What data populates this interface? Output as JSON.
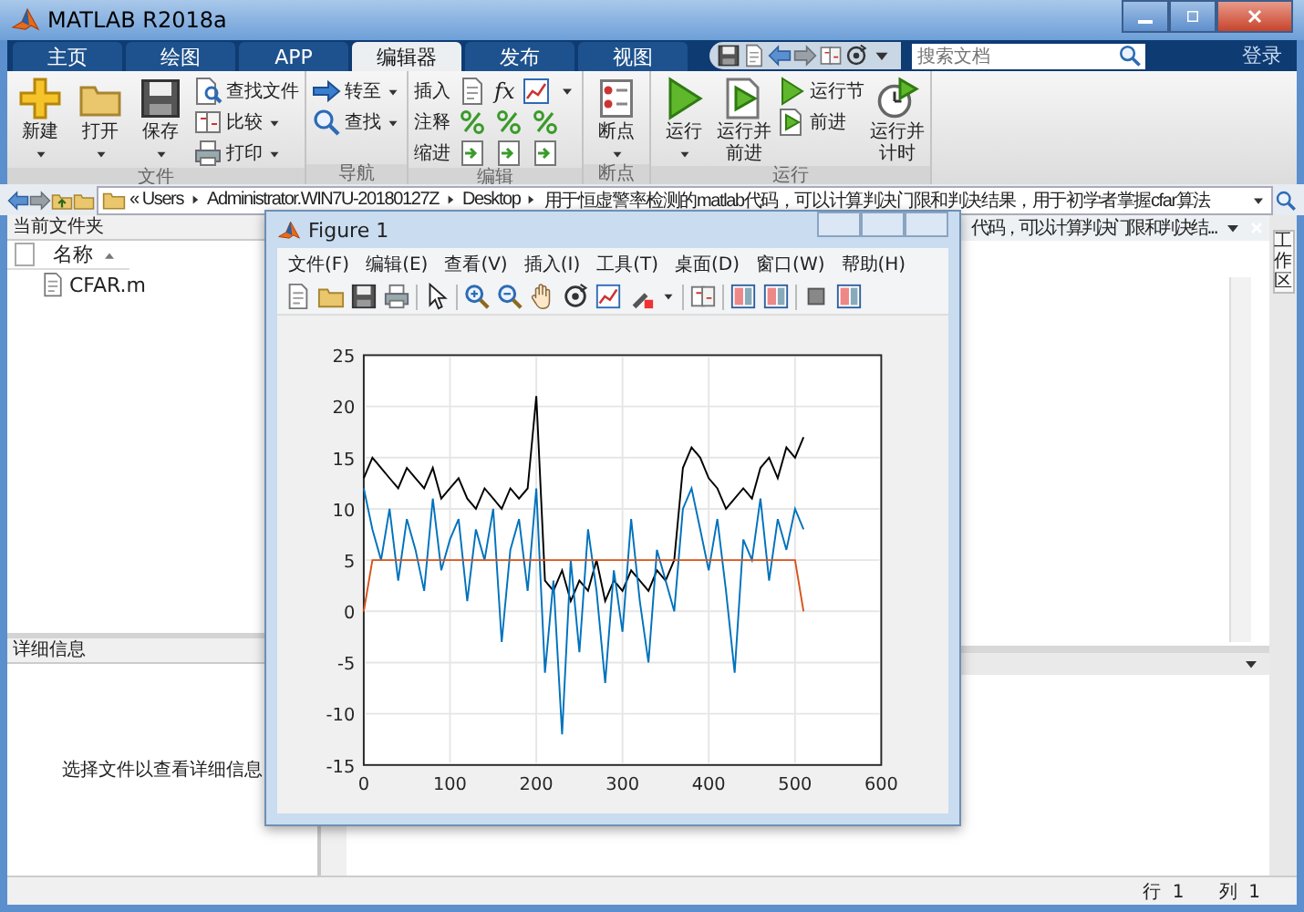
{
  "window": {
    "title": "MATLAB R2018a"
  },
  "tabs": [
    {
      "label": "主页",
      "selected": false
    },
    {
      "label": "绘图",
      "selected": false
    },
    {
      "label": "APP",
      "selected": false
    },
    {
      "label": "编辑器",
      "selected": true
    },
    {
      "label": "发布",
      "selected": false
    },
    {
      "label": "视图",
      "selected": false
    }
  ],
  "search": {
    "placeholder": "搜索文档"
  },
  "login": "登录",
  "ribbon": [
    {
      "title": "文件",
      "buttons": [
        {
          "label": "新建",
          "kind": "large",
          "dropdown": true
        },
        {
          "label": "打开",
          "kind": "large",
          "dropdown": true
        },
        {
          "label": "保存",
          "kind": "large",
          "dropdown": true
        },
        {
          "label": "查找文件",
          "kind": "small",
          "dropdown": false
        },
        {
          "label": "比较",
          "kind": "small",
          "dropdown": true
        },
        {
          "label": "打印",
          "kind": "small",
          "dropdown": true
        }
      ]
    },
    {
      "title": "导航",
      "buttons": [
        {
          "label": "转至",
          "kind": "small",
          "dropdown": true
        },
        {
          "label": "查找",
          "kind": "small",
          "dropdown": true
        }
      ]
    },
    {
      "title": "编辑",
      "buttons": [
        {
          "label": "插入",
          "kind": "small",
          "dropdown": false,
          "symbol": "fx"
        },
        {
          "label": "注释",
          "kind": "small",
          "dropdown": false
        },
        {
          "label": "缩进",
          "kind": "small",
          "dropdown": false
        }
      ]
    },
    {
      "title": "断点",
      "buttons": [
        {
          "label": "断点",
          "kind": "large",
          "dropdown": true
        }
      ]
    },
    {
      "title": "运行",
      "buttons": [
        {
          "label": "运行",
          "kind": "large",
          "dropdown": true
        },
        {
          "label": "运行并前进",
          "kind": "large",
          "dropdown": false
        },
        {
          "label": "运行节",
          "kind": "small",
          "dropdown": false
        },
        {
          "label": "前进",
          "kind": "small",
          "dropdown": false
        },
        {
          "label": "运行并计时",
          "kind": "large",
          "dropdown": false
        }
      ]
    }
  ],
  "address": {
    "overflow": "«",
    "path": [
      "Users",
      "Administrator.WIN7U-20180127Z",
      "Desktop",
      "用于恒虚警率检测的matlab代码，可以计算判决门限和判决结果，用于初学者掌握cfar算法"
    ]
  },
  "files": {
    "title": "当前文件夹",
    "column": "名称",
    "items": [
      {
        "name": "CFAR.m"
      }
    ]
  },
  "details": {
    "title": "详细信息",
    "message": "选择文件以查看详细信息"
  },
  "editor": {
    "tab_title": "代码，可以计算判决门限和判决结..."
  },
  "side_tab": "工作区",
  "figure": {
    "title": "Figure 1",
    "menus": [
      "文件(F)",
      "编辑(E)",
      "查看(V)",
      "插入(I)",
      "工具(T)",
      "桌面(D)",
      "窗口(W)",
      "帮助(H)"
    ],
    "chart_data": {
      "type": "line",
      "x": [
        0,
        10,
        20,
        30,
        40,
        50,
        60,
        70,
        80,
        90,
        100,
        110,
        120,
        130,
        140,
        150,
        160,
        170,
        180,
        190,
        200,
        210,
        220,
        230,
        240,
        250,
        260,
        270,
        280,
        290,
        300,
        310,
        320,
        330,
        340,
        350,
        360,
        370,
        380,
        390,
        400,
        410,
        420,
        430,
        440,
        450,
        460,
        470,
        480,
        490,
        500,
        510
      ],
      "grid": true,
      "series": [
        {
          "color": "#000000",
          "values": [
            13,
            15,
            14,
            13,
            12,
            14,
            13,
            12,
            14,
            11,
            12,
            13,
            11,
            10,
            12,
            11,
            10,
            12,
            11,
            12,
            21,
            3,
            2,
            4,
            1,
            3,
            2,
            5,
            1,
            3,
            2,
            4,
            3,
            2,
            4,
            3,
            5,
            14,
            16,
            15,
            13,
            12,
            10,
            11,
            12,
            11,
            14,
            15,
            13,
            16,
            15,
            17
          ]
        },
        {
          "color": "#0072bd",
          "values": [
            12,
            8,
            5,
            10,
            3,
            9,
            6,
            2,
            11,
            4,
            7,
            9,
            1,
            8,
            5,
            10,
            -3,
            6,
            9,
            2,
            12,
            -6,
            3,
            -12,
            5,
            -4,
            8,
            2,
            -7,
            4,
            -2,
            9,
            1,
            -5,
            6,
            3,
            0,
            10,
            12,
            8,
            4,
            9,
            2,
            -6,
            7,
            5,
            11,
            3,
            9,
            6,
            10,
            8
          ]
        },
        {
          "color": "#d95319",
          "values": [
            0,
            5,
            5,
            5,
            5,
            5,
            5,
            5,
            5,
            5,
            5,
            5,
            5,
            5,
            5,
            5,
            5,
            5,
            5,
            5,
            5,
            5,
            5,
            5,
            5,
            5,
            5,
            5,
            5,
            5,
            5,
            5,
            5,
            5,
            5,
            5,
            5,
            5,
            5,
            5,
            5,
            5,
            5,
            5,
            5,
            5,
            5,
            5,
            5,
            5,
            5,
            0
          ]
        }
      ],
      "xlim": [
        0,
        600
      ],
      "ylim": [
        -15,
        25
      ],
      "xticks": [
        0,
        100,
        200,
        300,
        400,
        500,
        600
      ],
      "yticks": [
        -15,
        -10,
        -5,
        0,
        5,
        10,
        15,
        20,
        25
      ]
    }
  },
  "status": {
    "row_label": "行",
    "row": "1",
    "col_label": "列",
    "col": "1"
  }
}
